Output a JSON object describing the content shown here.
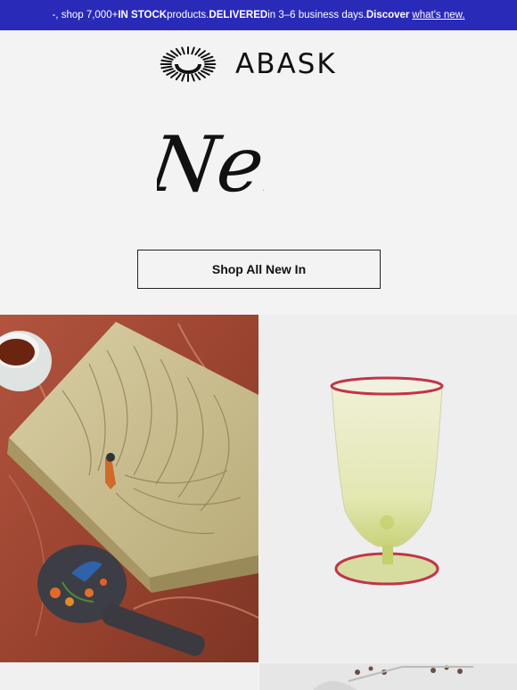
{
  "topbar": {
    "lead": "-, shop 7,000+ ",
    "in_stock": "IN STOCK",
    "mid": " products. ",
    "delivered": "DELIVERED",
    "tail": " in 3–6 business days. ",
    "discover": "Discover",
    "link": "what's new."
  },
  "brand": {
    "name": "ABASK"
  },
  "hero": {
    "script_text": "Nei"
  },
  "cta": {
    "label": "Shop All New In"
  },
  "icons": {
    "logo": "sunburst-logo-icon"
  },
  "colors": {
    "topbar": "#2a2ab8",
    "background": "#f3f3f3"
  }
}
